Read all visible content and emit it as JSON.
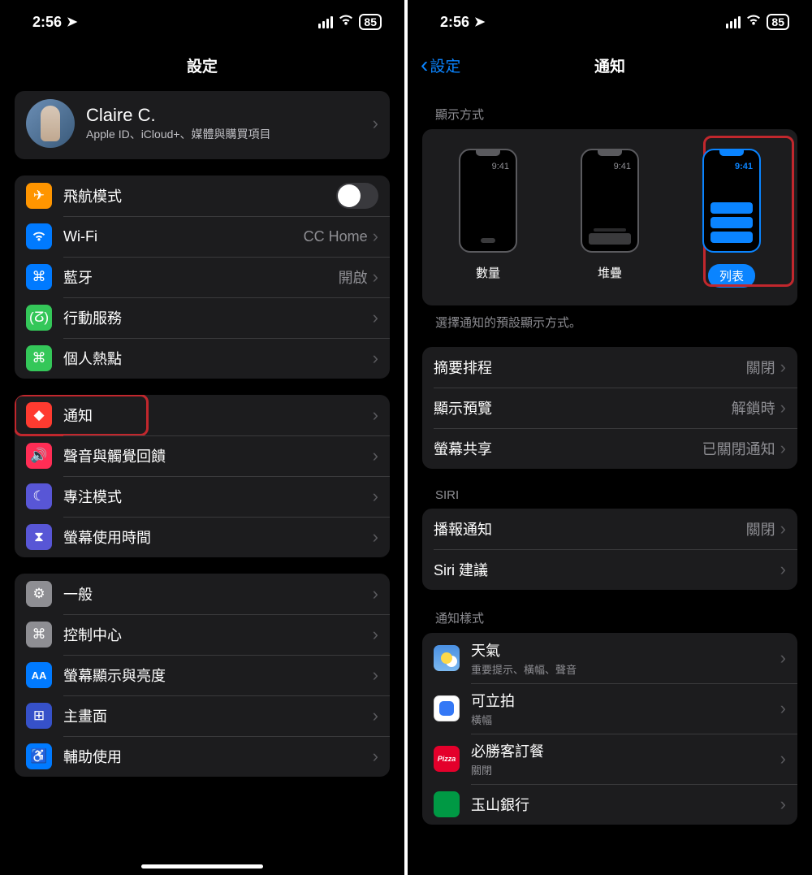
{
  "status": {
    "time": "2:56",
    "battery": "85"
  },
  "left": {
    "title": "設定",
    "profile": {
      "name": "Claire C.",
      "sub": "Apple ID、iCloud+、媒體與購買項目"
    },
    "g1": {
      "airplane": "飛航模式",
      "wifi": "Wi-Fi",
      "wifi_val": "CC Home",
      "bt": "藍牙",
      "bt_val": "開啟",
      "cell": "行動服務",
      "hotspot": "個人熱點"
    },
    "g2": {
      "notif": "通知",
      "sound": "聲音與觸覺回饋",
      "focus": "專注模式",
      "screentime": "螢幕使用時間"
    },
    "g3": {
      "general": "一般",
      "control": "控制中心",
      "display": "螢幕顯示與亮度",
      "home": "主畫面",
      "access": "輔助使用"
    }
  },
  "right": {
    "back": "設定",
    "title": "通知",
    "display_header": "顯示方式",
    "ds1": "數量",
    "ds2": "堆疊",
    "ds3": "列表",
    "ds_time": "9:41",
    "caption": "選擇通知的預設顯示方式。",
    "r1": {
      "summary": "摘要排程",
      "summary_val": "關閉",
      "preview": "顯示預覽",
      "preview_val": "解鎖時",
      "share": "螢幕共享",
      "share_val": "已關閉通知"
    },
    "siri_header": "SIRI",
    "r2": {
      "announce": "播報通知",
      "announce_val": "關閉",
      "suggest": "Siri 建議"
    },
    "style_header": "通知樣式",
    "apps": {
      "weather": "天氣",
      "weather_sub": "重要提示、橫幅、聲音",
      "clips": "可立拍",
      "clips_sub": "橫幅",
      "pizza": "必勝客訂餐",
      "pizza_sub": "關閉",
      "esun": "玉山銀行"
    }
  }
}
